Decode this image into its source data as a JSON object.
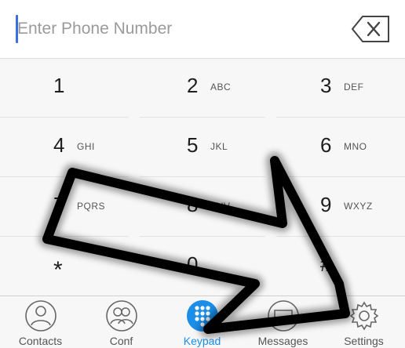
{
  "entry": {
    "placeholder": "Enter Phone Number",
    "backspace_icon": "backspace-icon"
  },
  "keypad": {
    "keys": [
      {
        "digit": "1",
        "letters": ""
      },
      {
        "digit": "2",
        "letters": "ABC"
      },
      {
        "digit": "3",
        "letters": "DEF"
      },
      {
        "digit": "4",
        "letters": "GHI"
      },
      {
        "digit": "5",
        "letters": "JKL"
      },
      {
        "digit": "6",
        "letters": "MNO"
      },
      {
        "digit": "7",
        "letters": "PQRS"
      },
      {
        "digit": "8",
        "letters": "TUV"
      },
      {
        "digit": "9",
        "letters": "WXYZ"
      },
      {
        "digit": "*",
        "letters": ""
      },
      {
        "digit": "0",
        "letters": ""
      },
      {
        "digit": "#",
        "letters": ""
      }
    ]
  },
  "tabs": [
    {
      "label": "Contacts",
      "icon": "contact-icon",
      "active": false
    },
    {
      "label": "Conf",
      "icon": "conference-icon",
      "active": false
    },
    {
      "label": "Keypad",
      "icon": "keypad-icon",
      "active": true
    },
    {
      "label": "Messages",
      "icon": "message-icon",
      "active": false
    },
    {
      "label": "Settings",
      "icon": "gear-icon",
      "active": false
    }
  ],
  "colors": {
    "accent": "#1a8ee8",
    "caret": "#3a6fe0",
    "annotation_arrow": "#000000"
  }
}
